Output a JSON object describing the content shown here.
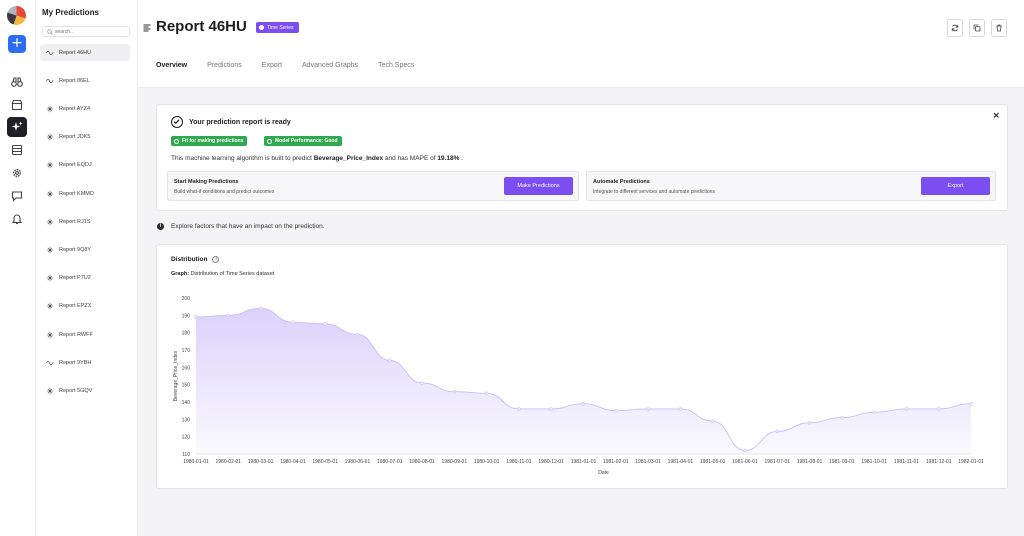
{
  "sidebar": {
    "title": "My Predictions",
    "search_placeholder": "search...",
    "items": [
      {
        "label": "Report 46HU",
        "icon": "wave-icon",
        "active": true
      },
      {
        "label": "Report 86EL",
        "icon": "wave-icon"
      },
      {
        "label": "Report AYZ4",
        "icon": "cluster-icon"
      },
      {
        "label": "Report JDK5",
        "icon": "cluster-icon"
      },
      {
        "label": "Report EQDJ",
        "icon": "cluster-icon"
      },
      {
        "label": "Report KMMD",
        "icon": "cluster-icon"
      },
      {
        "label": "Report RJ1S",
        "icon": "cluster-icon"
      },
      {
        "label": "Report 9Q8Y",
        "icon": "cluster-icon"
      },
      {
        "label": "Report P7U2",
        "icon": "cluster-icon"
      },
      {
        "label": "Report EPZX",
        "icon": "cluster-icon"
      },
      {
        "label": "Report RWFF",
        "icon": "cluster-icon"
      },
      {
        "label": "Report 9YBH",
        "icon": "wave-icon"
      },
      {
        "label": "Report 5GQV",
        "icon": "cluster-icon"
      }
    ]
  },
  "header": {
    "title": "Report 46HU",
    "badge": "Time Series",
    "tabs": [
      "Overview",
      "Predictions",
      "Export",
      "Advanced Graphs",
      "Tech Specs"
    ],
    "active_tab": "Overview"
  },
  "ready_card": {
    "title": "Your prediction report is ready",
    "pill_fit": "Fit for making predictions",
    "pill_perf": "Model Performance: Good",
    "desc_prefix": "This machine learning algorithm is built to predict ",
    "target": "Beverage_Price_Index",
    "desc_mid": " and has MAPE of ",
    "mape": "19.18%",
    "desc_suffix": " .",
    "box1": {
      "title": "Start Making Predictions",
      "subtitle": "Build what-if conditions and predict outcomes",
      "button": "Make Predictions"
    },
    "box2": {
      "title": "Automate Predictions",
      "subtitle": "Integrate to different services and automate predictions",
      "button": "Export"
    }
  },
  "explore_text": "Explore factors that have an impact on the prediction.",
  "distribution": {
    "title": "Distribution",
    "graph_prefix": "Graph:",
    "graph_text": "Distribution of Time Series dataset"
  },
  "colors": {
    "accent": "#7a4ef0",
    "success": "#2fa84f",
    "area_fill": "#d9d0fb"
  },
  "chart_data": {
    "type": "area",
    "xlabel": "Date",
    "ylabel": "Beverage_Price_Index",
    "ylim": [
      110,
      200
    ],
    "yticks": [
      110,
      120,
      130,
      140,
      150,
      160,
      170,
      180,
      190,
      200
    ],
    "x": [
      "1980-01-01",
      "1980-02-01",
      "1980-03-01",
      "1980-04-01",
      "1980-05-01",
      "1980-06-01",
      "1980-07-01",
      "1980-08-01",
      "1980-09-01",
      "1980-10-01",
      "1980-11-01",
      "1980-12-01",
      "1981-01-01",
      "1981-02-01",
      "1981-03-01",
      "1981-04-01",
      "1981-05-01",
      "1981-06-01",
      "1981-07-01",
      "1981-08-01",
      "1981-09-01",
      "1981-10-01",
      "1981-11-01",
      "1981-12-01",
      "1982-01-01"
    ],
    "values": [
      189,
      190,
      194,
      186,
      185,
      179,
      164,
      151,
      146,
      145,
      136,
      136,
      139,
      135,
      136,
      136,
      129,
      112,
      123,
      128,
      131,
      134,
      136,
      136,
      139
    ],
    "grid": false,
    "legend": "none"
  }
}
